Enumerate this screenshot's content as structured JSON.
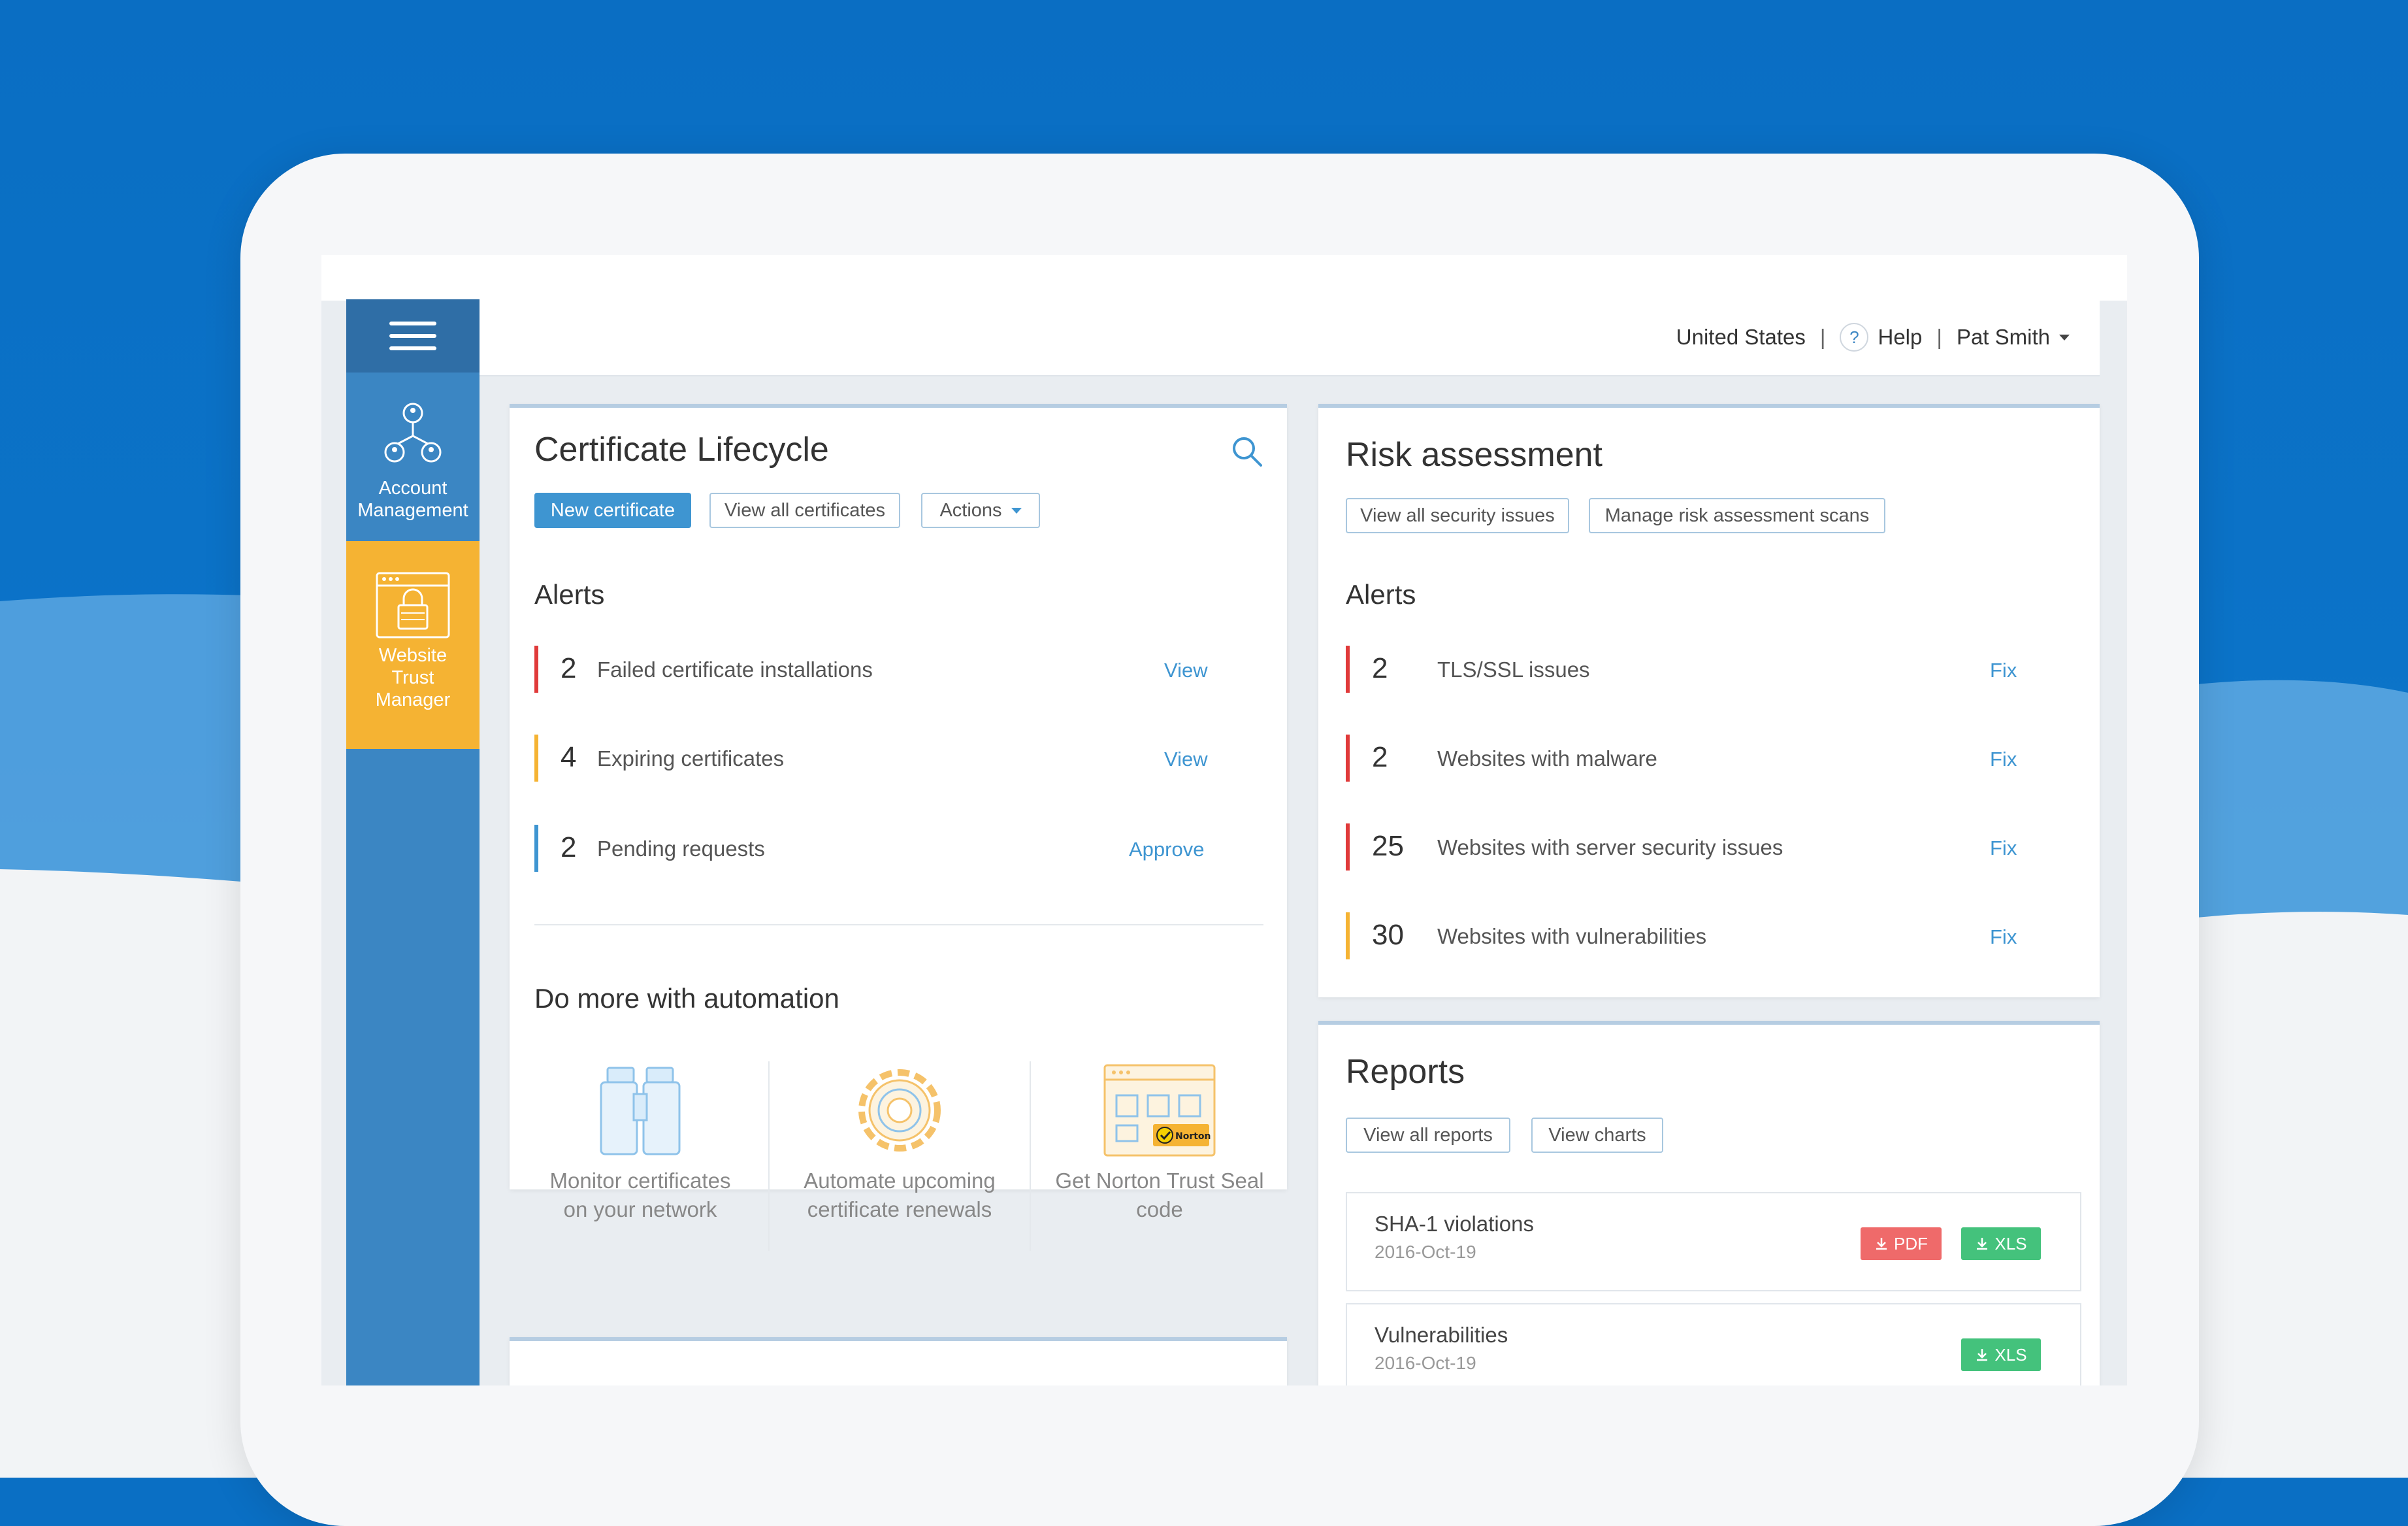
{
  "header": {
    "country": "United States",
    "help_label": "Help",
    "help_symbol": "?",
    "user_name": "Pat Smith"
  },
  "sidebar": {
    "items": [
      {
        "label_lines": [
          "Account",
          "Management"
        ],
        "icon": "account-network-icon",
        "active": false
      },
      {
        "label_lines": [
          "Website",
          "Trust",
          "Manager"
        ],
        "icon": "browser-lock-icon",
        "active": true
      }
    ]
  },
  "certificate_lifecycle": {
    "title": "Certificate Lifecycle",
    "buttons": {
      "new_certificate": "New certificate",
      "view_all_certificates": "View all certificates",
      "actions": "Actions"
    },
    "alerts_title": "Alerts",
    "alerts": [
      {
        "count": "2",
        "label": "Failed certificate installations",
        "action": "View",
        "color": "#e03a3a"
      },
      {
        "count": "4",
        "label": "Expiring certificates",
        "action": "View",
        "color": "#f5b333"
      },
      {
        "count": "2",
        "label": "Pending requests",
        "action": "Approve",
        "color": "#3e95d1"
      }
    ],
    "automation_title": "Do more with automation",
    "automation": [
      {
        "lines": [
          "Monitor certificates",
          "on your network"
        ],
        "icon": "binoculars-icon"
      },
      {
        "lines": [
          "Automate upcoming",
          "certificate renewals"
        ],
        "icon": "gear-icon"
      },
      {
        "lines": [
          "Get Norton Trust Seal",
          "code"
        ],
        "icon": "norton-seal-icon",
        "seal_text": "Norton"
      }
    ]
  },
  "risk_assessment": {
    "title": "Risk assessment",
    "buttons": {
      "view_all_security_issues": "View all security issues",
      "manage_scans": "Manage risk assessment scans"
    },
    "alerts_title": "Alerts",
    "alerts": [
      {
        "count": "2",
        "label": "TLS/SSL issues",
        "action": "Fix",
        "color": "#e03a3a"
      },
      {
        "count": "2",
        "label": "Websites with malware",
        "action": "Fix",
        "color": "#e03a3a"
      },
      {
        "count": "25",
        "label": "Websites with server security issues",
        "action": "Fix",
        "color": "#e03a3a"
      },
      {
        "count": "30",
        "label": "Websites with vulnerabilities",
        "action": "Fix",
        "color": "#f5b333"
      }
    ]
  },
  "reports": {
    "title": "Reports",
    "buttons": {
      "view_all_reports": "View all reports",
      "view_charts": "View charts"
    },
    "rows": [
      {
        "name": "SHA-1 violations",
        "date": "2016-Oct-19",
        "pdf": "PDF",
        "xls": "XLS"
      },
      {
        "name": "Vulnerabilities",
        "date": "2016-Oct-19",
        "xls": "XLS"
      }
    ]
  }
}
